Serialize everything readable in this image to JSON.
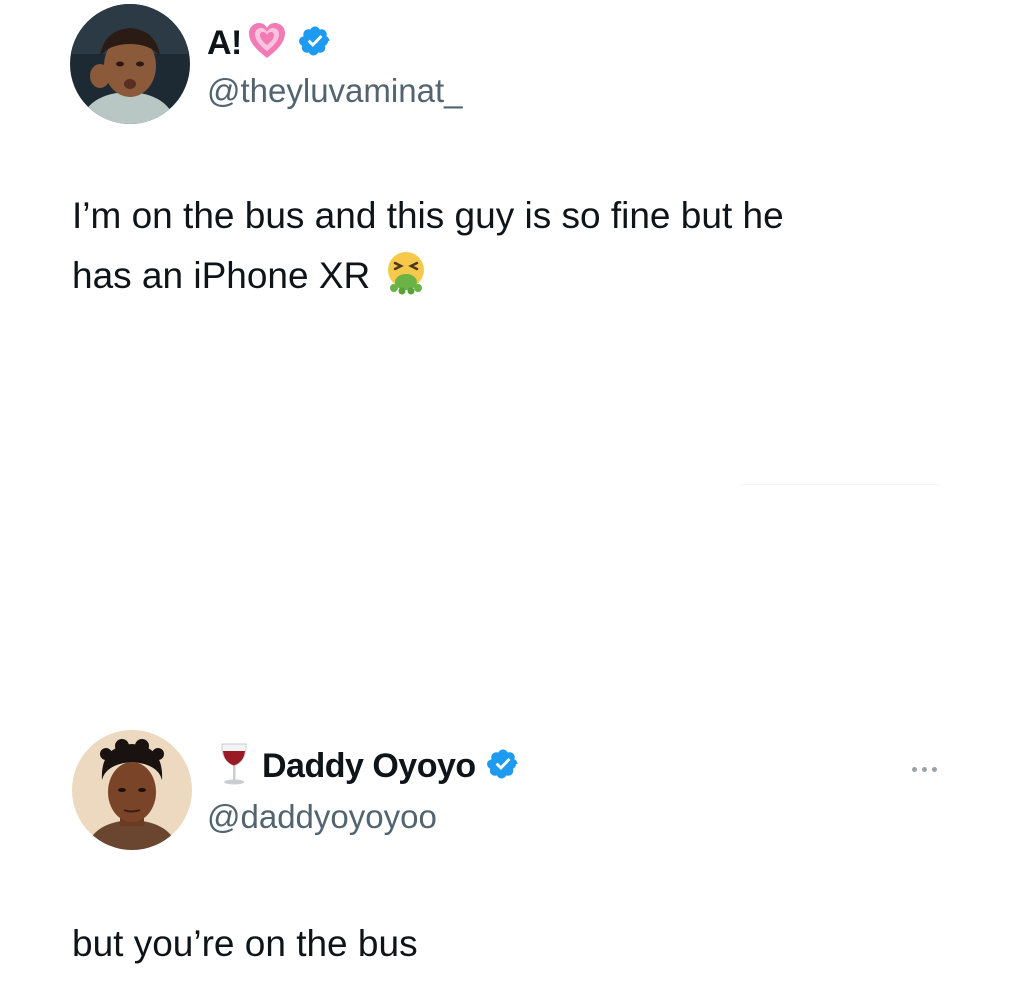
{
  "tweets": [
    {
      "display_name": "A!",
      "name_emoji": "growing-heart-icon",
      "handle": "@theyluvaminat_",
      "verified": true,
      "text_line1": "I’m on the bus and this guy is so fine but he",
      "text_line2": "has an iPhone XR",
      "text_emoji": "vomiting-face-icon"
    },
    {
      "name_emoji": "wine-glass-icon",
      "display_name": "Daddy Oyoyo",
      "handle": "@daddyoyoyoo",
      "verified": true,
      "text_line1": "but you’re on the bus",
      "more_icon": "more-options-icon"
    }
  ],
  "colors": {
    "text": "#0f1419",
    "secondary": "#536471",
    "verified_blue": "#1d9bf0",
    "background": "#ffffff"
  }
}
